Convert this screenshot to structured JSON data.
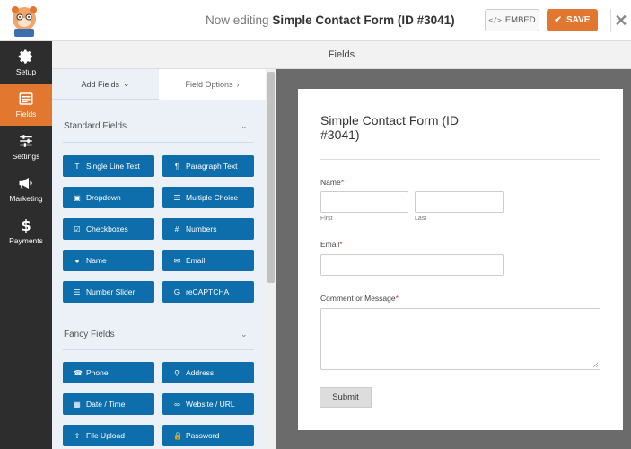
{
  "topbar": {
    "editing_prefix": "Now editing",
    "form_name": "Simple Contact Form (ID #3041)",
    "embed_label": "EMBED",
    "save_label": "SAVE",
    "close_glyph": "✕"
  },
  "leftnav": {
    "items": [
      {
        "label": "Setup",
        "icon": "gear-icon"
      },
      {
        "label": "Fields",
        "icon": "fields-list-icon"
      },
      {
        "label": "Settings",
        "icon": "sliders-icon"
      },
      {
        "label": "Marketing",
        "icon": "megaphone-icon"
      },
      {
        "label": "Payments",
        "icon": "dollar-icon"
      }
    ],
    "active": "Fields"
  },
  "header": {
    "title": "Fields"
  },
  "panel": {
    "tabs": [
      {
        "label": "Add Fields",
        "chevron": "⌄"
      },
      {
        "label": "Field Options",
        "chevron": "›"
      }
    ],
    "standard": {
      "title": "Standard Fields",
      "chevron": "⌄",
      "buttons": [
        {
          "label": "Single Line Text",
          "icon": "text-icon",
          "glyph": "T"
        },
        {
          "label": "Paragraph Text",
          "icon": "paragraph-icon",
          "glyph": "¶"
        },
        {
          "label": "Dropdown",
          "icon": "dropdown-icon",
          "glyph": "▣"
        },
        {
          "label": "Multiple Choice",
          "icon": "list-icon",
          "glyph": "☰"
        },
        {
          "label": "Checkboxes",
          "icon": "checkbox-icon",
          "glyph": "☑"
        },
        {
          "label": "Numbers",
          "icon": "hash-icon",
          "glyph": "#"
        },
        {
          "label": "Name",
          "icon": "user-icon",
          "glyph": "●"
        },
        {
          "label": "Email",
          "icon": "envelope-icon",
          "glyph": "✉"
        },
        {
          "label": "Number Slider",
          "icon": "slider-icon",
          "glyph": "☰"
        },
        {
          "label": "reCAPTCHA",
          "icon": "google-icon",
          "glyph": "G"
        }
      ]
    },
    "fancy": {
      "title": "Fancy Fields",
      "chevron": "⌄",
      "buttons": [
        {
          "label": "Phone",
          "icon": "phone-icon",
          "glyph": "☎"
        },
        {
          "label": "Address",
          "icon": "map-marker-icon",
          "glyph": "⚲"
        },
        {
          "label": "Date / Time",
          "icon": "calendar-icon",
          "glyph": "▦"
        },
        {
          "label": "Website / URL",
          "icon": "link-icon",
          "glyph": "∞"
        },
        {
          "label": "File Upload",
          "icon": "upload-icon",
          "glyph": "⇪"
        },
        {
          "label": "Password",
          "icon": "lock-icon",
          "glyph": "🔒"
        }
      ]
    }
  },
  "preview": {
    "title": "Simple Contact Form (ID #3041)",
    "fields": {
      "name_label": "Name",
      "first_sub": "First",
      "last_sub": "Last",
      "email_label": "Email",
      "message_label": "Comment or Message",
      "required_mark": "*"
    },
    "submit_label": "Submit"
  },
  "colors": {
    "accent": "#e27730",
    "field_button": "#0e6eab",
    "nav_bg": "#2d2d2d",
    "preview_bg": "#6b6b6b"
  }
}
